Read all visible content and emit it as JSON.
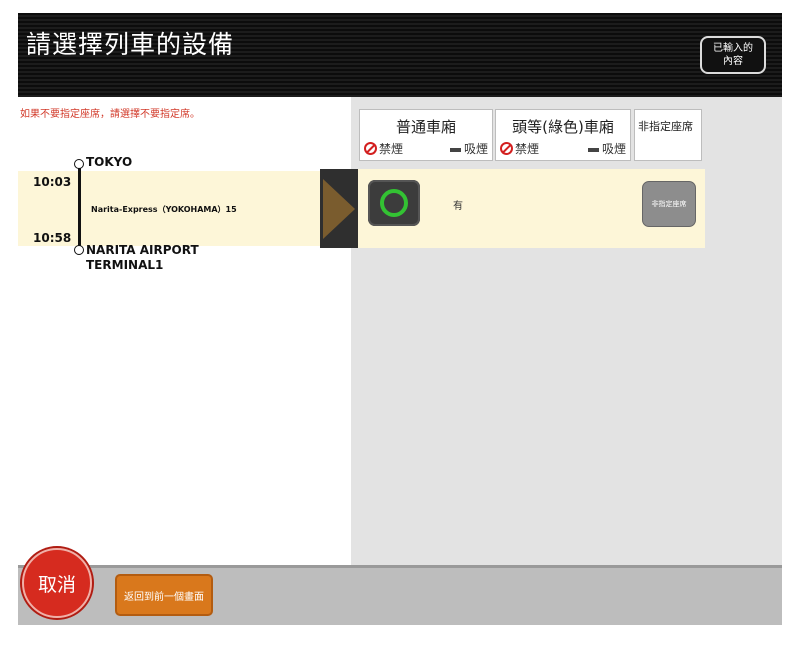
{
  "header": {
    "title": "請選擇列車的設備",
    "entered_button_label": "已輸入的\n內容"
  },
  "hint": "如果不要指定座席，請選擇不要指定席。",
  "columns": {
    "ordinary": {
      "name": "普通車廂",
      "no_smoking": "禁煙",
      "smoking": "吸煙"
    },
    "green": {
      "name": "頭等(綠色)車廂",
      "no_smoking": "禁煙",
      "smoking": "吸煙"
    },
    "non_reserved": {
      "name": "非指定座席"
    }
  },
  "train": {
    "depart_station": "TOKYO",
    "depart_time": "10:03",
    "name": "Narita-Express（YOKOHAMA）15",
    "arrive_time": "10:58",
    "arrive_station_line1": "NARITA AIRPORT",
    "arrive_station_line2": "TERMINAL1"
  },
  "seat": {
    "availability_text": "有",
    "non_reserved_button": "非指定座席"
  },
  "footer": {
    "cancel_label": "取消",
    "back_label": "返回到前一個畫面"
  },
  "colors": {
    "accent_red": "#d62b1f",
    "back_orange": "#d9781c",
    "available_green": "#33c233",
    "band": "#fdf6d8"
  }
}
